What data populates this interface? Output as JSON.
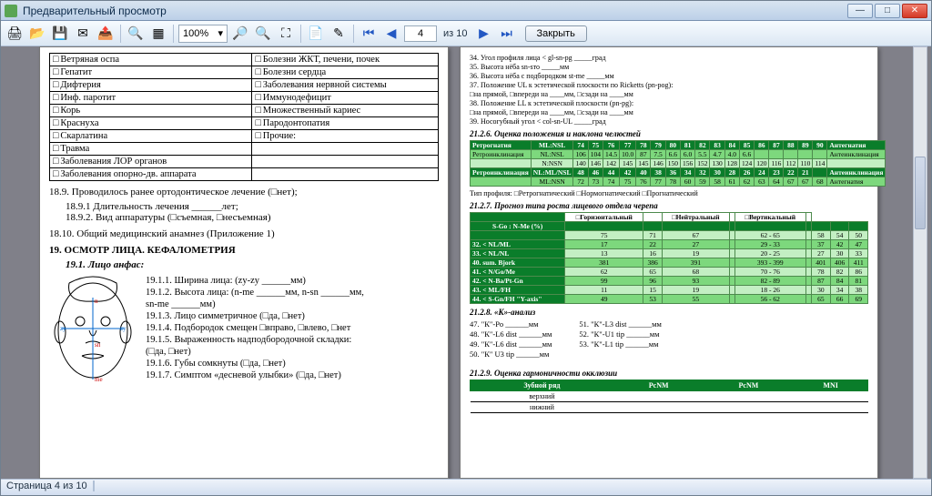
{
  "window": {
    "title": "Предварительный просмотр"
  },
  "winbuttons": {
    "min": "—",
    "max": "□",
    "close": "✕"
  },
  "toolbar": {
    "zoom": "100%",
    "page_current": "4",
    "page_sep": "из",
    "page_total": "10",
    "close": "Закрыть"
  },
  "left": {
    "diseases": [
      [
        "Ветряная оспа",
        "Болезни ЖКТ, печени, почек"
      ],
      [
        "Гепатит",
        "Болезни сердца"
      ],
      [
        "Дифтерия",
        "Заболевания нервной системы"
      ],
      [
        "Инф. паротит",
        "Иммунодефицит"
      ],
      [
        "Корь",
        "Множественный кариес"
      ],
      [
        "Краснуха",
        "Пародонтопатия"
      ],
      [
        "Скарлатина",
        "Прочие:"
      ],
      [
        "Травма",
        ""
      ],
      [
        "Заболевания ЛОР органов",
        ""
      ],
      [
        "Заболевания опорно-дв. аппарата",
        ""
      ]
    ],
    "s189": "18.9. Проводилось ранее ортодонтическое лечение (□нет);",
    "s1891": "18.9.1 Длительность лечения ______лет;",
    "s1892": "18.9.2. Вид аппаратуры (□съемная, □несъемная)",
    "s1810": "18.10. Общий медицинский анамнез   (Приложение 1)",
    "s19": "19. ОСМОТР ЛИЦА. КЕФАЛОМЕТРИЯ",
    "s191": "19.1. Лицо анфас:",
    "s1911": "19.1.1. Ширина лица: (zy-zy ______мм)",
    "s1912a": "19.1.2. Высота лица: (n-me ______мм, n-sn ______мм,",
    "s1912b": "sn-me ______мм)",
    "s1913": "19.1.3. Лицо симметричное (□да, □нет)",
    "s1914": "19.1.4. Подбородок смещен □вправо, □влево, □нет",
    "s1915": "19.1.5. Выраженность надподбородочной складки:",
    "s1915b": "(□да, □нет)",
    "s1916": "19.1.6. Губы сомкнуты (□да, □нет)",
    "s1917": "19.1.7. Симптом «десневой улыбки» (□да, □нет)"
  },
  "right": {
    "lines_top": [
      "34. Угол профиля лица          < gl-sn-pg        _____град",
      "35. Высота нёба                    sn-sто            _____мм",
      "36. Высота нёба с подбородком st-me           _____мм",
      "37. Положение UL к эстетической плоскости по Ricketts (pn-pog):",
      "    □на прямой, □впереди на ____мм, □сзади на ____мм",
      "38. Положение LL к эстетической плоскости (pn-pg):",
      "    □на прямой, □впереди на ____мм, □сзади на ____мм",
      "39. Носогубный угол          < col-sn-UL        _____град"
    ],
    "h216": "21.2.6. Оценка положения и наклона челюстей",
    "t216_rows": [
      {
        "cls": "hdr",
        "label": "Ретрогнатия",
        "sub": "ML:NSL",
        "v": [
          "74",
          "75",
          "76",
          "77",
          "78",
          "79",
          "80",
          "81",
          "82",
          "83",
          "84",
          "85",
          "86",
          "87",
          "88",
          "89",
          "90"
        ],
        "note": "Антегнатия"
      },
      {
        "cls": "alt",
        "label": "Ретроинклинация",
        "sub": "NL:NSL",
        "v": [
          "106",
          "104",
          "14.5",
          "10.0",
          "87",
          "7.5",
          "6.6",
          "6.0",
          "5.5",
          "4.7",
          "4.0",
          "6.6",
          "",
          "",
          "",
          "",
          ""
        ],
        "note": "Антеинклинация"
      },
      {
        "cls": "lt",
        "label": "",
        "sub": "N:NSN",
        "v": [
          "140",
          "146",
          "142",
          "145",
          "145",
          "146",
          "150",
          "156",
          "152",
          "130",
          "128",
          "124",
          "120",
          "116",
          "112",
          "110",
          "114"
        ],
        "note": ""
      },
      {
        "cls": "hdr",
        "label": "Ретроинклинация",
        "sub": "NL:ML/NSL",
        "v": [
          "48",
          "46",
          "44",
          "42",
          "40",
          "38",
          "36",
          "34",
          "32",
          "30",
          "28",
          "26",
          "24",
          "23",
          "22",
          "21",
          ""
        ],
        "note": "Антеинклинация"
      },
      {
        "cls": "alt",
        "label": "",
        "sub": "ML:NSN",
        "v": [
          "72",
          "73",
          "74",
          "75",
          "76",
          "77",
          "78",
          "60",
          "59",
          "58",
          "61",
          "62",
          "63",
          "64",
          "67",
          "67",
          "68"
        ],
        "note": "Антегнатия"
      }
    ],
    "t216_profile_row": "Тип профиля:     □Ретрогнатический     □Нормогнатический     □Прогнатический",
    "h217": "21.2.7. Прогноз типа роста лицевого отдела черепа",
    "t217_head": [
      "",
      "□Горизонтальный",
      "",
      "□Нейтральный",
      "",
      "□Вертикальный",
      ""
    ],
    "t217_sub": "S-Go : N-Me (%)",
    "t217_rows": [
      {
        "label": "",
        "v": [
          "75",
          "71",
          "67",
          "",
          "62 - 65",
          "",
          "58",
          "54",
          "50"
        ]
      },
      {
        "label": "32. < NL/ML",
        "v": [
          "17",
          "22",
          "27",
          "",
          "29 - 33",
          "",
          "37",
          "42",
          "47"
        ]
      },
      {
        "label": "33. < NL/NL",
        "v": [
          "13",
          "16",
          "19",
          "",
          "20 - 25",
          "",
          "27",
          "30",
          "33"
        ]
      },
      {
        "label": "40. sum. Bjork",
        "v": [
          "381",
          "386",
          "391",
          "",
          "393 - 399",
          "",
          "401",
          "406",
          "411"
        ]
      },
      {
        "label": "41. < N/Go/Me",
        "v": [
          "62",
          "65",
          "68",
          "",
          "70 - 76",
          "",
          "78",
          "82",
          "86"
        ]
      },
      {
        "label": "42. < N-Ba/Pt-Gn",
        "v": [
          "99",
          "96",
          "93",
          "",
          "82 - 89",
          "",
          "87",
          "84",
          "81"
        ]
      },
      {
        "label": "43. < ML/FH",
        "v": [
          "11",
          "15",
          "19",
          "",
          "18 - 26",
          "",
          "30",
          "34",
          "38"
        ]
      },
      {
        "label": "44. < S-Gn/FH \"Y-axis\"",
        "v": [
          "49",
          "53",
          "55",
          "",
          "56 - 62",
          "",
          "65",
          "66",
          "69"
        ]
      }
    ],
    "h218": "21.2.8. «К»-анализ",
    "k_left": [
      "47. \"К\"-Po ______мм",
      "48. \"К\"-L6 dist ______мм",
      "49. \"К\"-L6 dist ______мм",
      "50. \"К\" U3 tip ______мм"
    ],
    "k_right": [
      "51. \"К\"-L3 dist ______мм",
      "52. \"К\"-U1 tip ______мм",
      "53. \"К\"-L1 tip ______мм"
    ],
    "h219": "21.2.9. Оценка гармоничности окклюзии",
    "occ_head": [
      "Зубной ряд",
      "PсNM",
      "PсNM",
      "MNI"
    ],
    "occ_rows": [
      "верхний",
      "нижний"
    ]
  },
  "status": {
    "text": "Страница 4 из 10"
  }
}
